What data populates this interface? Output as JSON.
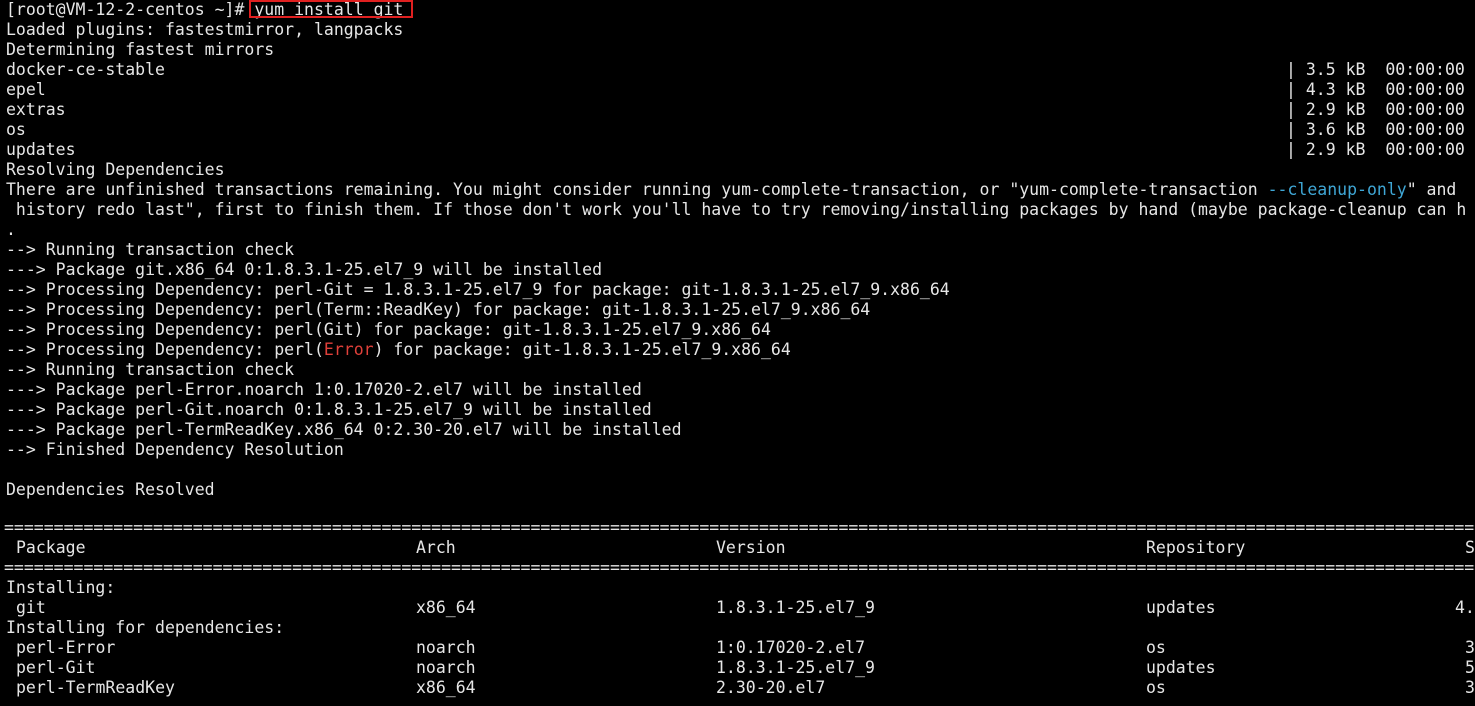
{
  "terminal": {
    "prompt": "[root@VM-12-2-centos ~]# ",
    "command": "yum install git",
    "colors": {
      "background": "#000000",
      "foreground": "#e6e6e6",
      "highlight_box": "#e02020",
      "option_cyan": "#3fa7d6",
      "error_red": "#e0403a"
    },
    "lines": {
      "plugins": "Loaded plugins: fastestmirror, langpacks",
      "mirrors": "Determining fastest mirrors",
      "resolving": "Resolving Dependencies",
      "unfinished_pre": "There are unfinished transactions remaining. You might consider running yum-complete-transaction, or \"yum-complete-transaction ",
      "unfinished_opt": "--cleanup-only",
      "unfinished_post": "\" and",
      "history": " history redo last\", first to finish them. If those don't work you'll have to try removing/installing packages by hand (maybe package-cleanup can h",
      "dot": ".",
      "check1": "--> Running transaction check",
      "pkg_git": "---> Package git.x86_64 0:1.8.3.1-25.el7_9 will be installed",
      "dep1": "--> Processing Dependency: perl-Git = 1.8.3.1-25.el7_9 for package: git-1.8.3.1-25.el7_9.x86_64",
      "dep2": "--> Processing Dependency: perl(Term::ReadKey) for package: git-1.8.3.1-25.el7_9.x86_64",
      "dep3": "--> Processing Dependency: perl(Git) for package: git-1.8.3.1-25.el7_9.x86_64",
      "dep4_pre": "--> Processing Dependency: perl(",
      "dep4_err": "Error",
      "dep4_post": ") for package: git-1.8.3.1-25.el7_9.x86_64",
      "check2": "--> Running transaction check",
      "pkg_error": "---> Package perl-Error.noarch 1:0.17020-2.el7 will be installed",
      "pkg_perlgit": "---> Package perl-Git.noarch 0:1.8.3.1-25.el7_9 will be installed",
      "pkg_readkey": "---> Package perl-TermReadKey.x86_64 0:2.30-20.el7 will be installed",
      "finished": "--> Finished Dependency Resolution",
      "resolved": "Dependencies Resolved",
      "separator": "=============================================================================================================================================================="
    },
    "repos": [
      {
        "name": "docker-ce-stable",
        "size": "| 3.5 kB  00:00:00"
      },
      {
        "name": "epel",
        "size": "| 4.3 kB  00:00:00"
      },
      {
        "name": "extras",
        "size": "| 2.9 kB  00:00:00"
      },
      {
        "name": "os",
        "size": "| 3.6 kB  00:00:00"
      },
      {
        "name": "updates",
        "size": "| 2.9 kB  00:00:00"
      }
    ],
    "table": {
      "headers": {
        "package": "Package",
        "arch": "Arch",
        "version": "Version",
        "repository": "Repository",
        "size": "S"
      },
      "installing_label": "Installing:",
      "deps_label": "Installing for dependencies:",
      "rows": [
        {
          "package": "git",
          "arch": "x86_64",
          "version": "1.8.3.1-25.el7_9",
          "repository": "updates",
          "size": "4."
        },
        {
          "package": "perl-Error",
          "arch": "noarch",
          "version": "1:0.17020-2.el7",
          "repository": "os",
          "size": "3"
        },
        {
          "package": "perl-Git",
          "arch": "noarch",
          "version": "1.8.3.1-25.el7_9",
          "repository": "updates",
          "size": "5"
        },
        {
          "package": "perl-TermReadKey",
          "arch": "x86_64",
          "version": "2.30-20.el7",
          "repository": "os",
          "size": "3"
        }
      ]
    }
  }
}
